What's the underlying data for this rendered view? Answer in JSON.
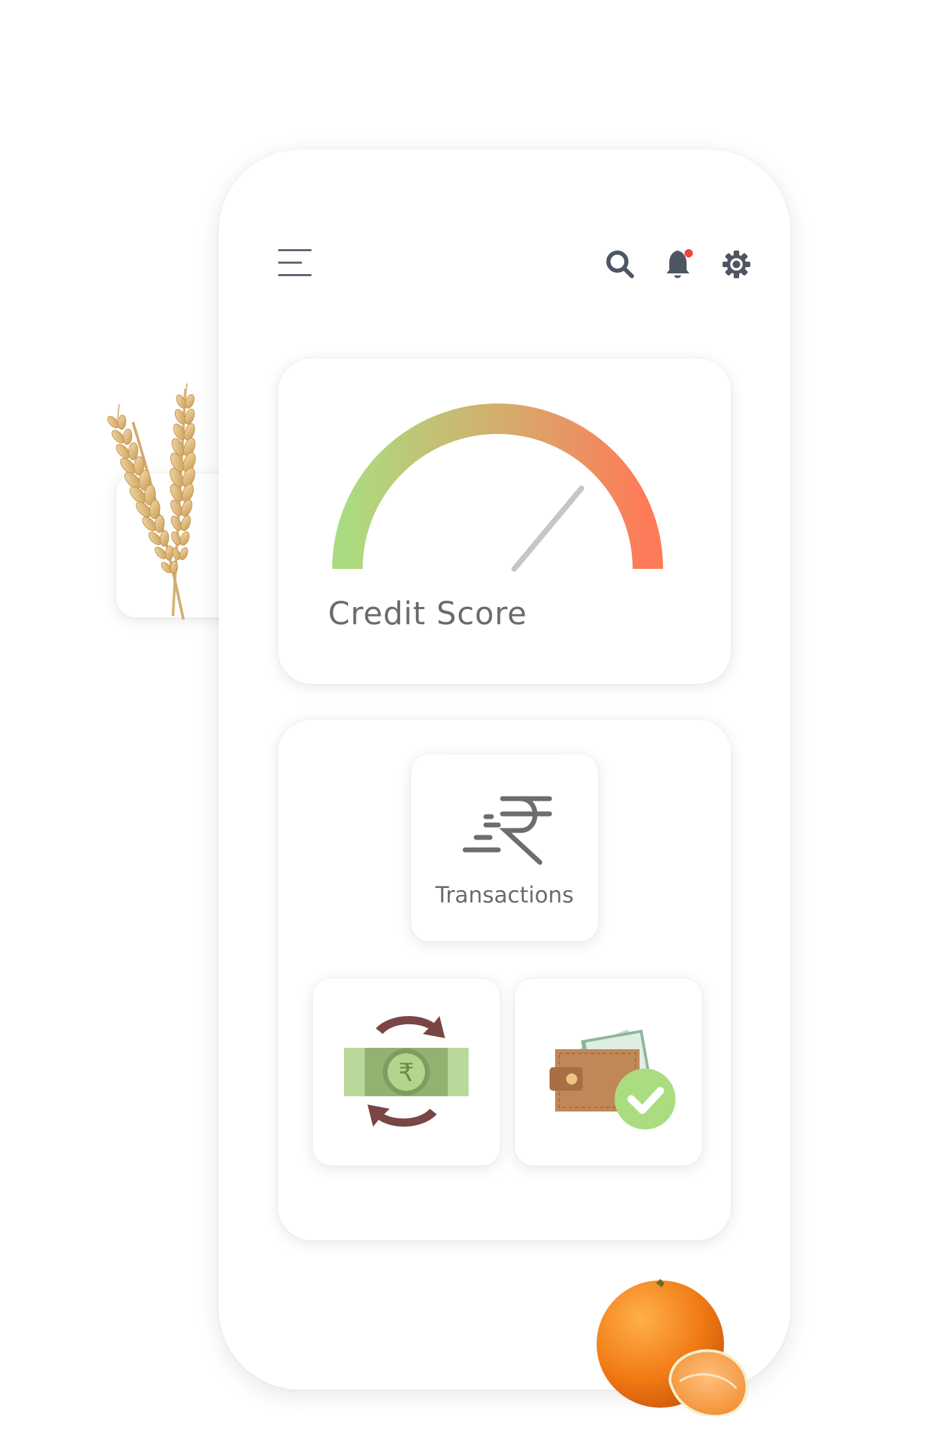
{
  "header": {
    "menu_icon": "hamburger-menu-icon",
    "actions": [
      {
        "icon": "search-icon"
      },
      {
        "icon": "bell-icon",
        "badge_color": "#f0473a"
      },
      {
        "icon": "gear-icon"
      }
    ]
  },
  "credit_card": {
    "label": "Credit Score",
    "gauge_colors": [
      "#abdb80",
      "#d3ae6c",
      "#ff7a58"
    ],
    "needle_color": "#c6c6c6",
    "needle_level": 0.72
  },
  "services": {
    "transactions": {
      "label": "Transactions",
      "icon": "rupee-transaction-icon",
      "icon_color": "#6d6d6d"
    },
    "money_exchange": {
      "icon": "money-exchange-icon",
      "note_color": "#93b272",
      "arrow_color": "#7a4545",
      "symbol": "₹"
    },
    "wallet": {
      "icon": "wallet-check-icon",
      "wallet_color": "#c08759",
      "check_color": "#aadd80"
    }
  },
  "decorations": {
    "left": "wheat-icon",
    "bottom": "orange-fruit-icon"
  }
}
